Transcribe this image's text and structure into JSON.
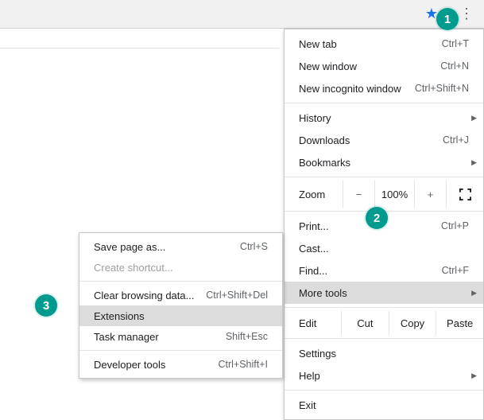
{
  "toolbar": {
    "star_glyph": "★",
    "kebab_glyph": "⋮"
  },
  "menu": {
    "new_tab": "New tab",
    "new_tab_accel": "Ctrl+T",
    "new_window": "New window",
    "new_window_accel": "Ctrl+N",
    "new_incognito": "New incognito window",
    "new_incognito_accel": "Ctrl+Shift+N",
    "history": "History",
    "downloads": "Downloads",
    "downloads_accel": "Ctrl+J",
    "bookmarks": "Bookmarks",
    "zoom_label": "Zoom",
    "zoom_minus": "−",
    "zoom_value": "100%",
    "zoom_plus": "+",
    "print": "Print...",
    "print_accel": "Ctrl+P",
    "cast": "Cast...",
    "find": "Find...",
    "find_accel": "Ctrl+F",
    "more_tools": "More tools",
    "edit_label": "Edit",
    "cut": "Cut",
    "copy": "Copy",
    "paste": "Paste",
    "settings": "Settings",
    "help": "Help",
    "exit": "Exit"
  },
  "submenu": {
    "save_page": "Save page as...",
    "save_page_accel": "Ctrl+S",
    "create_shortcut": "Create shortcut...",
    "clear_data": "Clear browsing data...",
    "clear_data_accel": "Ctrl+Shift+Del",
    "extensions": "Extensions",
    "task_manager": "Task manager",
    "task_manager_accel": "Shift+Esc",
    "dev_tools": "Developer tools",
    "dev_tools_accel": "Ctrl+Shift+I"
  },
  "markers": {
    "one": "1",
    "two": "2",
    "three": "3"
  }
}
